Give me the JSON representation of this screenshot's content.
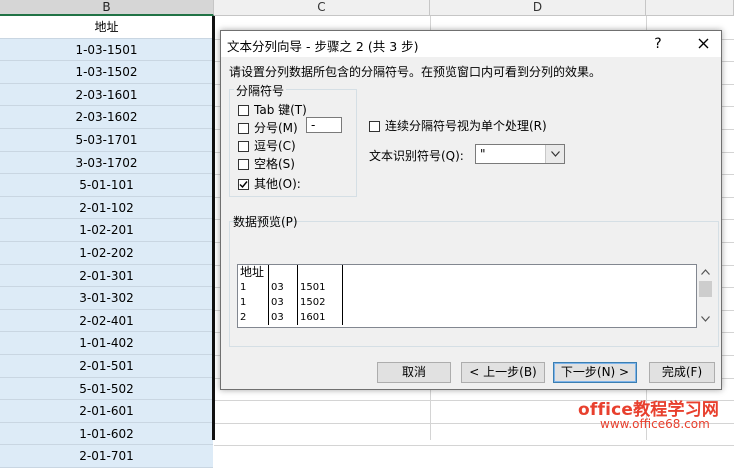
{
  "sheet": {
    "columns": [
      "B",
      "C",
      "D"
    ],
    "column_b_values": [
      "地址",
      "1-03-1501",
      "1-03-1502",
      "2-03-1601",
      "2-03-1602",
      "5-03-1701",
      "3-03-1702",
      "5-01-101",
      "2-01-102",
      "1-02-201",
      "1-02-202",
      "2-01-301",
      "3-01-302",
      "2-02-401",
      "1-01-402",
      "2-01-501",
      "5-01-502",
      "2-01-601",
      "1-01-602",
      "2-01-701"
    ]
  },
  "dialog": {
    "title": "文本分列向导 - 步骤之 2 (共 3 步)",
    "help": "?",
    "instruction": "请设置分列数据所包含的分隔符号。在预览窗口内可看到分列的效果。",
    "delimiters": {
      "legend": "分隔符号",
      "options": [
        {
          "label": "Tab 键(T)",
          "checked": false
        },
        {
          "label": "分号(M)",
          "checked": false
        },
        {
          "label": "逗号(C)",
          "checked": false
        },
        {
          "label": "空格(S)",
          "checked": false
        },
        {
          "label": "其他(O):",
          "checked": true
        }
      ],
      "other_value": "-"
    },
    "consecutive": {
      "label": "连续分隔符号视为单个处理(R)",
      "checked": false
    },
    "qualifier": {
      "label": "文本识别符号(Q):",
      "value": "\""
    },
    "preview": {
      "label": "数据预览(P)",
      "rows": [
        [
          "地址",
          "",
          ""
        ],
        [
          "1",
          "03",
          "1501"
        ],
        [
          "1",
          "03",
          "1502"
        ],
        [
          "2",
          "03",
          "1601"
        ]
      ]
    },
    "buttons": {
      "cancel": "取消",
      "back": "< 上一步(B)",
      "next": "下一步(N) >",
      "finish": "完成(F)"
    }
  },
  "watermark": {
    "line1": "office教程学习网",
    "line2": "www.office68.com"
  },
  "colors": {
    "selected_fill": "#ddebf7",
    "watermark": "#e8402e"
  }
}
